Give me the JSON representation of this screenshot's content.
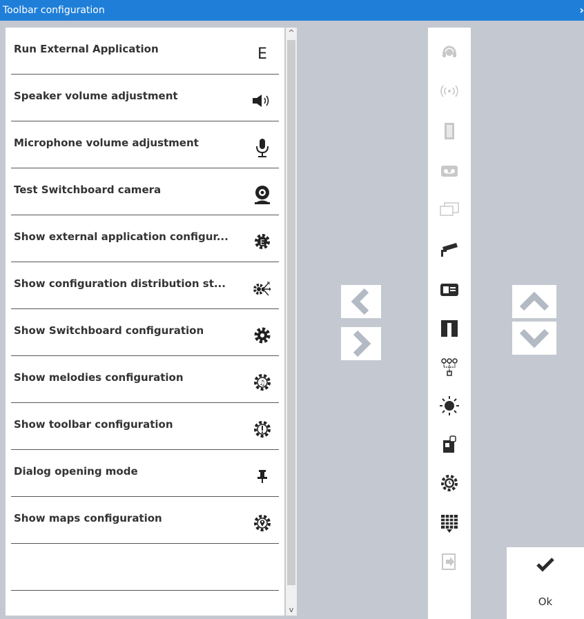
{
  "window": {
    "title": "Toolbar configuration",
    "close_glyph": "›"
  },
  "list": {
    "items": [
      {
        "label": "Run External Application",
        "icon": "letter-e-icon",
        "glyph": "E"
      },
      {
        "label": "Speaker volume adjustment",
        "icon": "speaker-icon"
      },
      {
        "label": "Microphone volume adjustment",
        "icon": "microphone-icon"
      },
      {
        "label": "Test Switchboard camera",
        "icon": "webcam-icon"
      },
      {
        "label": "Show  external application configur...",
        "icon": "gear-e-icon"
      },
      {
        "label": "Show  configuration  distribution st...",
        "icon": "gear-share-icon"
      },
      {
        "label": "Show Switchboard configuration",
        "icon": "gear-icon"
      },
      {
        "label": "Show melodies configuration",
        "icon": "gear-music-icon"
      },
      {
        "label": "Show toolbar configuration",
        "icon": "gear-info-icon"
      },
      {
        "label": "Dialog opening mode",
        "icon": "pin-icon"
      },
      {
        "label": "Show maps configuration",
        "icon": "gear-map-icon"
      },
      {
        "label": "",
        "icon": ""
      }
    ]
  },
  "toolbar_icons": [
    {
      "name": "headset-icon",
      "enabled": false
    },
    {
      "name": "broadcast-icon",
      "enabled": false
    },
    {
      "name": "door-icon",
      "enabled": false
    },
    {
      "name": "voicemail-icon",
      "enabled": false
    },
    {
      "name": "chat-icon",
      "enabled": false
    },
    {
      "name": "security-camera-icon",
      "enabled": true
    },
    {
      "name": "id-card-icon",
      "enabled": true
    },
    {
      "name": "double-door-icon",
      "enabled": true
    },
    {
      "name": "network-icon",
      "enabled": true
    },
    {
      "name": "brightness-icon",
      "enabled": true
    },
    {
      "name": "lock-phone-icon",
      "enabled": true
    },
    {
      "name": "gear-clock-icon",
      "enabled": true
    },
    {
      "name": "keypad-icon",
      "enabled": true
    },
    {
      "name": "logout-icon",
      "enabled": false
    }
  ],
  "ok": {
    "label": "Ok"
  },
  "colors": {
    "titlebar": "#1f7fd8",
    "background": "#c4c9d1",
    "arrow": "#b3bac4",
    "icon": "#2b2b2b",
    "icon_disabled": "#c8c8c8"
  }
}
